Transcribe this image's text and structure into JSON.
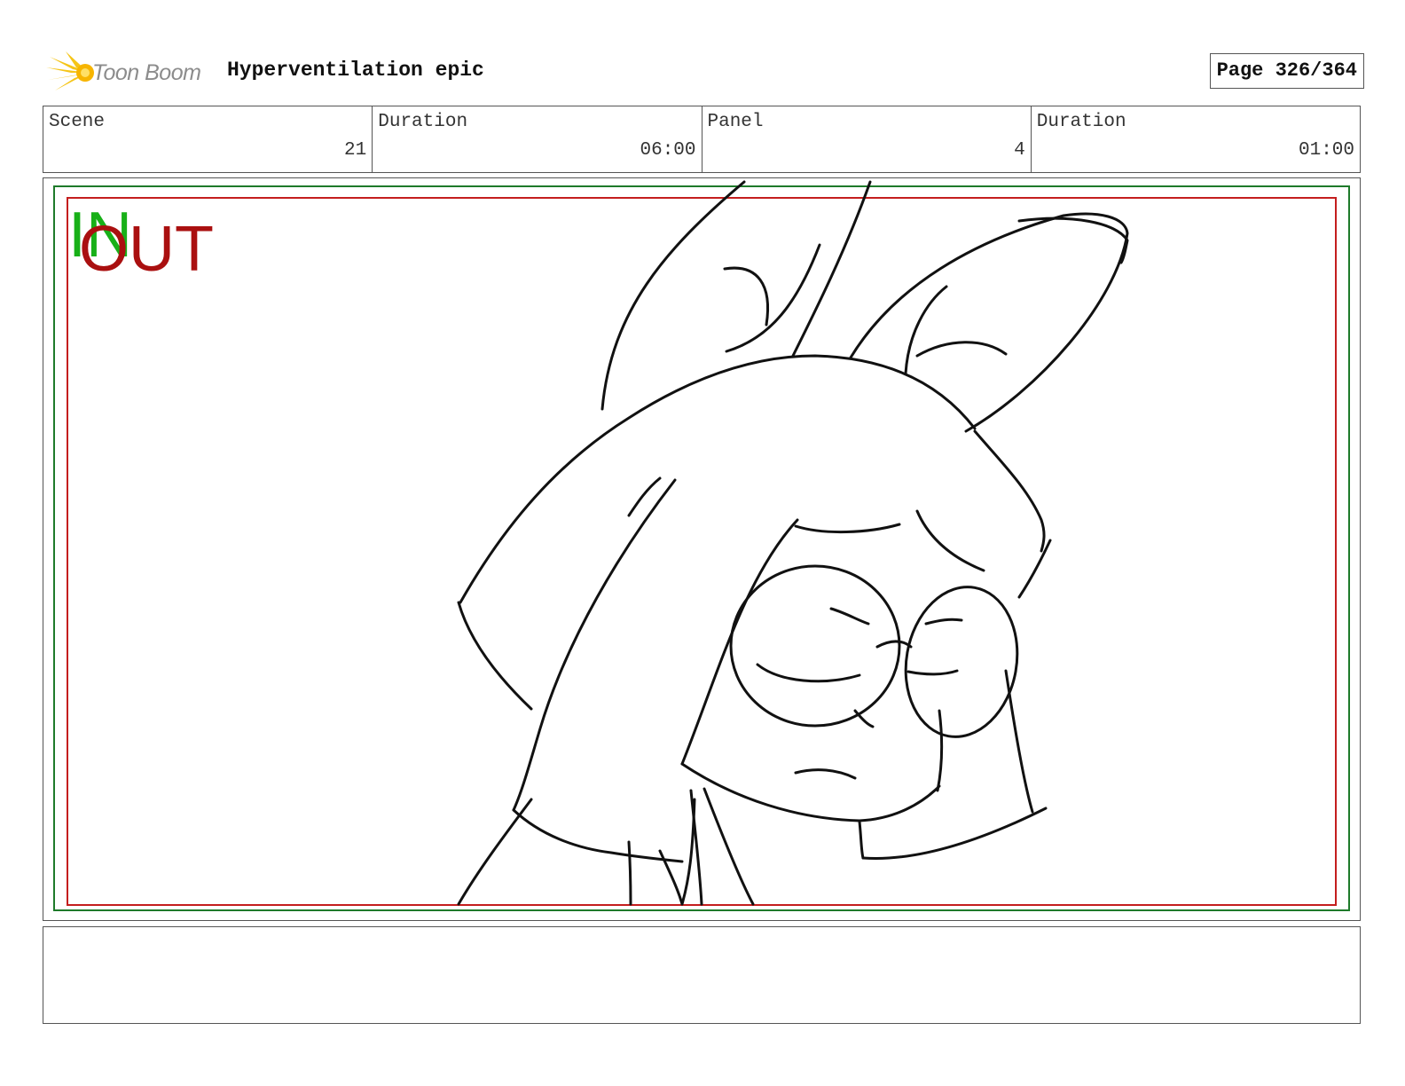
{
  "header": {
    "logo_text": "Toon Boom",
    "project_title": "Hyperventilation epic",
    "page_label": "Page 326/364"
  },
  "info": {
    "scene_label": "Scene",
    "scene_value": "21",
    "scene_duration_label": "Duration",
    "scene_duration_value": "06:00",
    "panel_label": "Panel",
    "panel_value": "4",
    "panel_duration_label": "Duration",
    "panel_duration_value": "01:00"
  },
  "panel": {
    "in_marker": "IN",
    "out_marker": "OUT"
  },
  "notes": {
    "text": ""
  }
}
